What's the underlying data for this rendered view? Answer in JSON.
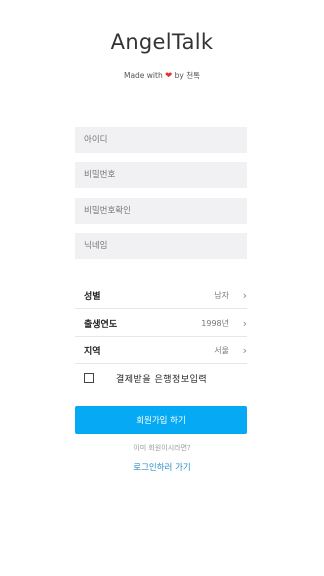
{
  "app": {
    "title": "AngelTalk"
  },
  "tagline": {
    "prefix": "Made with",
    "heart": "❤",
    "suffix": "by 천톡"
  },
  "form": {
    "id_placeholder": "아이디",
    "password_placeholder": "비밀번호",
    "password_confirm_placeholder": "비밀번호확인",
    "nickname_placeholder": "닉네임"
  },
  "rows": {
    "gender": {
      "label": "성별",
      "value": "남자"
    },
    "birth_year": {
      "label": "출생연도",
      "value": "1998년"
    },
    "region": {
      "label": "지역",
      "value": "서울"
    }
  },
  "bank_checkbox": {
    "label": "결제받을 은행정보입력",
    "checked": false
  },
  "signup_button": "회원가입 하기",
  "already_member": "이미 회원이시라면?",
  "login_link": "로그인하러 가기",
  "colors": {
    "primary": "#05a9f4",
    "heart": "#e0322f",
    "field_bg": "#f1f0f3"
  }
}
